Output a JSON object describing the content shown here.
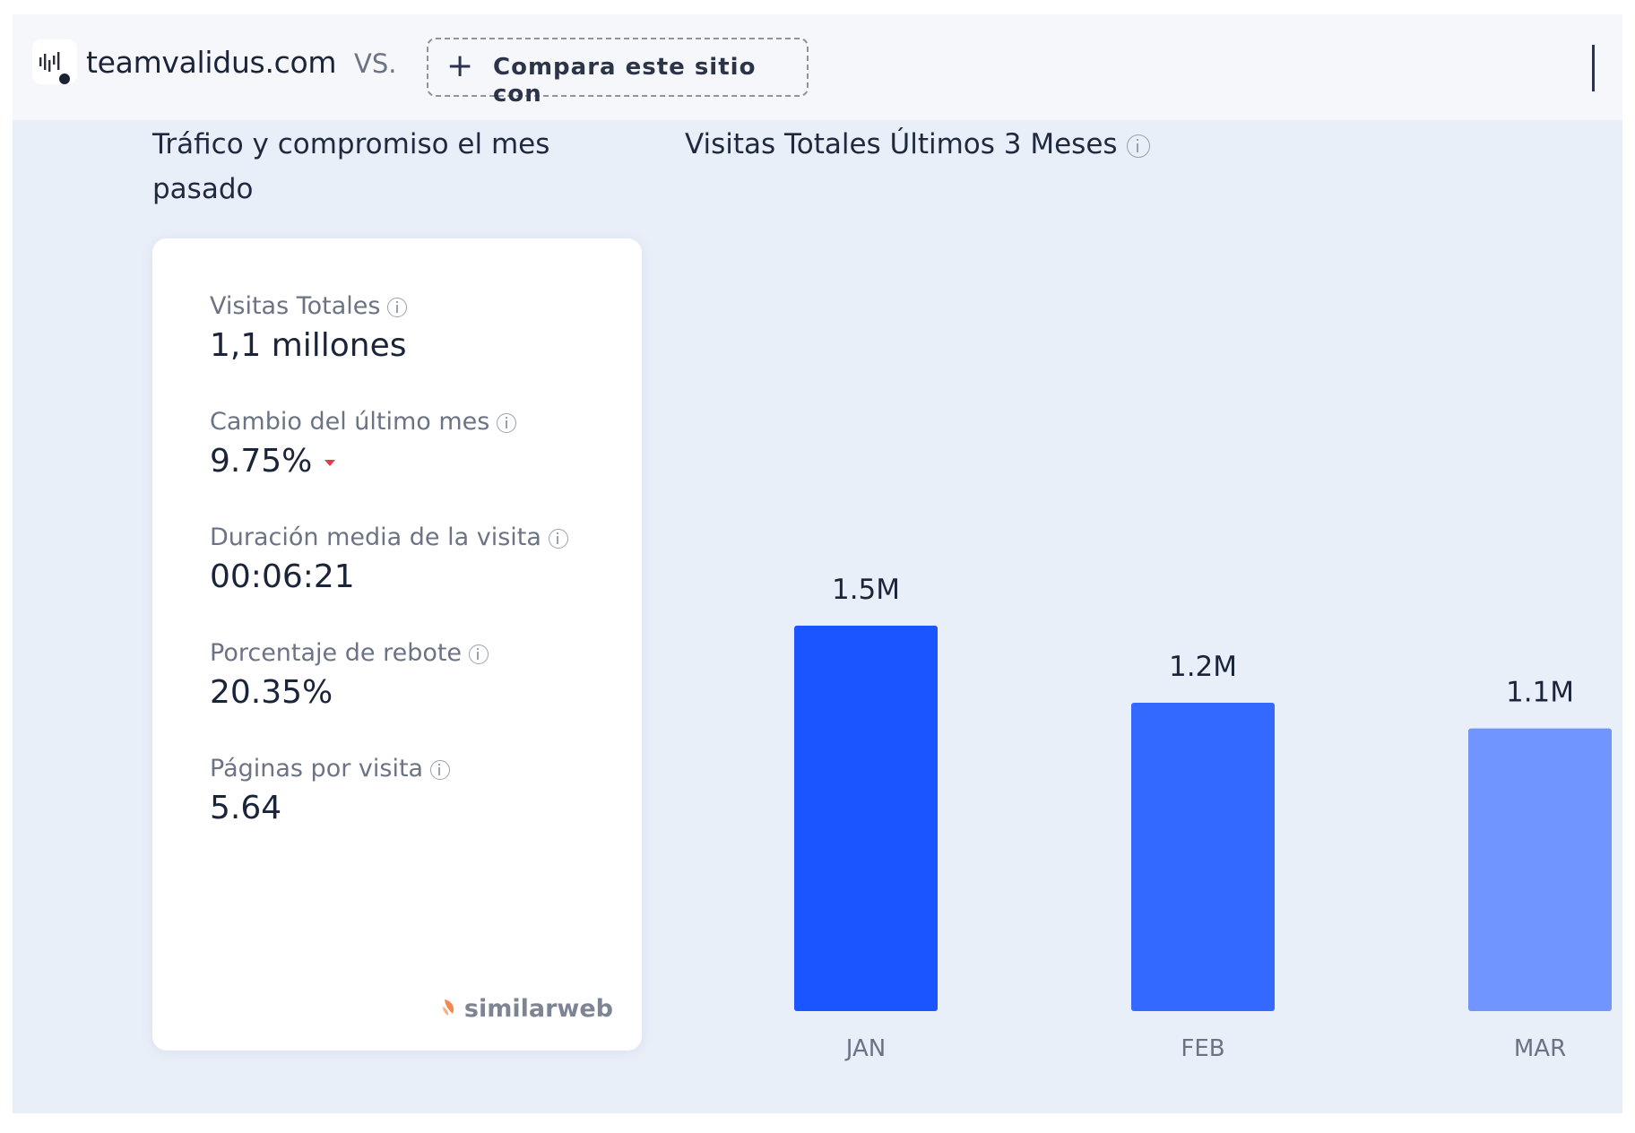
{
  "header": {
    "domain": "teamvalidus.com",
    "vs_label": "VS.",
    "compare_button_label": "Compara este sitio con",
    "favicon_icon": "waveform-logo-icon"
  },
  "overview": {
    "title": "Tráfico y compromiso el mes pasado",
    "metrics": [
      {
        "label": "Visitas Totales",
        "value": "1,1 millones"
      },
      {
        "label": "Cambio del último mes",
        "value": "9.75%",
        "trend": "down",
        "trend_color": "#e8384f"
      },
      {
        "label": "Duración media de la visita",
        "value": "00:06:21"
      },
      {
        "label": "Porcentaje de rebote",
        "value": "20.35%"
      },
      {
        "label": "Páginas por visita",
        "value": "5.64"
      }
    ],
    "brand": "similarweb"
  },
  "chart_data": {
    "type": "bar",
    "title": "Visitas Totales Últimos 3 Meses",
    "categories": [
      "JAN",
      "FEB",
      "MAR"
    ],
    "values": [
      1.5,
      1.2,
      1.1
    ],
    "data_labels": [
      "1.5M",
      "1.2M",
      "1.1M"
    ],
    "unit": "M",
    "bar_colors": [
      "#1a55ff",
      "#3369ff",
      "#7096fd"
    ],
    "ylim": [
      0,
      1.5
    ],
    "grid": false,
    "legend": "none"
  }
}
